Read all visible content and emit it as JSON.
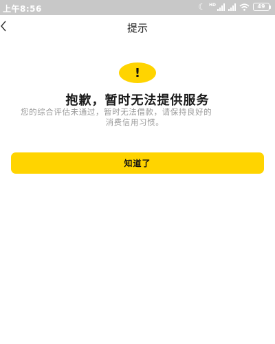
{
  "status_bar": {
    "time": "上午8:56",
    "network_tag": "HD",
    "battery_level": "49",
    "icons": [
      "moon-icon",
      "signal-icon",
      "signal-icon",
      "wifi-icon",
      "battery-icon"
    ]
  },
  "nav": {
    "back_icon": "chevron-left-icon",
    "title": "提示"
  },
  "alert": {
    "icon_symbol": "!",
    "icon_name": "exclamation-icon",
    "headline": "抱歉，暂时无法提供服务",
    "description_line1": "您的综合评估未通过，暂时无法借款，请保持良好的",
    "description_line2": "消费信用习惯。"
  },
  "actions": {
    "confirm_label": "知道了"
  },
  "colors": {
    "accent": "#ffd400",
    "status_bar_bg": "#c8c8c8",
    "description_text": "#9a9a9a"
  }
}
